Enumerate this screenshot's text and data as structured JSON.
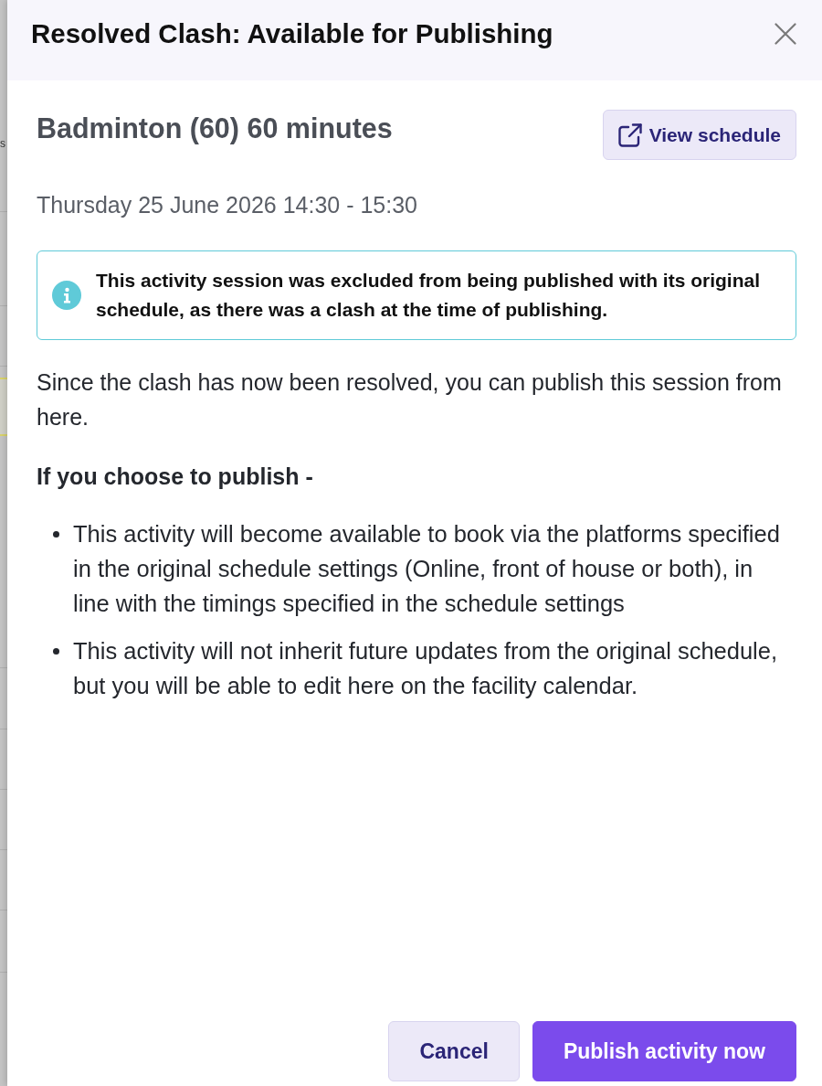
{
  "backdrop": {
    "fragment": "s"
  },
  "dialog": {
    "title": "Resolved Clash: Available for Publishing"
  },
  "session": {
    "name": "Badminton (60) 60 minutes",
    "datetime": "Thursday 25 June 2026 14:30 - 15:30",
    "view_button": "View schedule"
  },
  "notice": {
    "kind": "info",
    "text": "This activity session was excluded from being published with its original schedule, as there was a clash at the time of publishing."
  },
  "description": "Since the clash has now been resolved, you can publish this session from here.",
  "publish_heading": "If you choose to publish -",
  "consequences": [
    "This activity will become available to book via the platforms specified in the original schedule settings (Online, front of house or both), in line with the timings specified in the schedule settings",
    "This activity will not inherit future updates from the original schedule, but you will be able to edit here on the facility calendar."
  ],
  "buttons": [
    {
      "label": "Cancel",
      "kind": "secondary"
    },
    {
      "label": "Publish activity now",
      "kind": "primary"
    }
  ]
}
